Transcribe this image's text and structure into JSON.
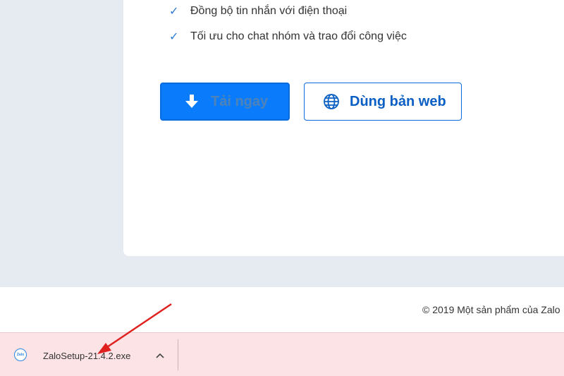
{
  "features": [
    {
      "icon": "checkmark-icon",
      "text": "Đồng bộ tin nhắn với điện thoại"
    },
    {
      "icon": "checkmark-icon",
      "text": "Tối ưu cho chat nhóm và trao đổi công việc"
    }
  ],
  "check_glyph": "✓",
  "buttons": {
    "download_label": "Tải ngay",
    "web_label": "Dùng bản web"
  },
  "footer": {
    "copyright": "© 2019 Một sản phẩm của Zalo"
  },
  "download_bar": {
    "file_icon_text": "Zalo",
    "file_name": "ZaloSetup-21.4.2.exe"
  },
  "colors": {
    "accent": "#0a7cfb",
    "download_bar_bg": "#fbe3e6",
    "arrow": "#e0201e"
  }
}
